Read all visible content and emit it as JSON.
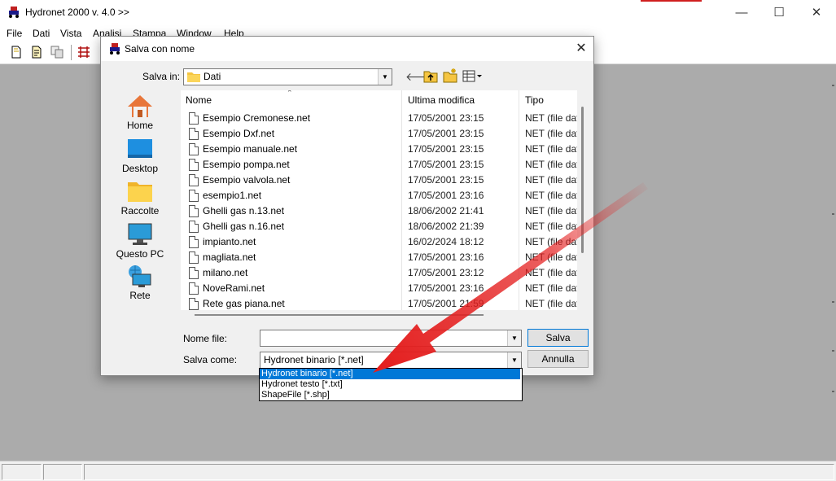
{
  "app": {
    "title": "Hydronet 2000 v. 4.0 >>",
    "window_buttons": {
      "minimize": "—",
      "maximize": "☐",
      "close": "✕"
    }
  },
  "menu": [
    "File",
    "Dati",
    "Vista",
    "Analisi",
    "Stampa",
    "Window",
    "Help"
  ],
  "dialog": {
    "title": "Salva con nome",
    "close": "✕",
    "save_in_label": "Salva in:",
    "save_in_value": "Dati",
    "places": [
      {
        "label": "Home",
        "icon": "home-icon"
      },
      {
        "label": "Desktop",
        "icon": "desktop-icon"
      },
      {
        "label": "Raccolte",
        "icon": "folder-icon"
      },
      {
        "label": "Questo PC",
        "icon": "computer-icon"
      },
      {
        "label": "Rete",
        "icon": "network-icon"
      }
    ],
    "columns": [
      "Nome",
      "Ultima modifica",
      "Tipo"
    ],
    "files": [
      {
        "name": "Esempio Cremonese.net",
        "modified": "17/05/2001 23:15",
        "type": "NET (file dat"
      },
      {
        "name": "Esempio Dxf.net",
        "modified": "17/05/2001 23:15",
        "type": "NET (file dat"
      },
      {
        "name": "Esempio manuale.net",
        "modified": "17/05/2001 23:15",
        "type": "NET (file dat"
      },
      {
        "name": "Esempio pompa.net",
        "modified": "17/05/2001 23:15",
        "type": "NET (file dat"
      },
      {
        "name": "Esempio valvola.net",
        "modified": "17/05/2001 23:15",
        "type": "NET (file dat"
      },
      {
        "name": "esempio1.net",
        "modified": "17/05/2001 23:16",
        "type": "NET (file dat"
      },
      {
        "name": "Ghelli gas n.13.net",
        "modified": "18/06/2002 21:41",
        "type": "NET (file dat"
      },
      {
        "name": "Ghelli gas n.16.net",
        "modified": "18/06/2002 21:39",
        "type": "NET (file dat"
      },
      {
        "name": "impianto.net",
        "modified": "16/02/2024 18:12",
        "type": "NET (file dat"
      },
      {
        "name": "magliata.net",
        "modified": "17/05/2001 23:16",
        "type": "NET (file dat"
      },
      {
        "name": "milano.net",
        "modified": "17/05/2001 23:12",
        "type": "NET (file dat"
      },
      {
        "name": "NoveRami.net",
        "modified": "17/05/2001 23:16",
        "type": "NET (file dat"
      },
      {
        "name": "Rete gas piana.net",
        "modified": "17/05/2001 21:59",
        "type": "NET (file dat"
      }
    ],
    "filename_label": "Nome file:",
    "filename_value": "",
    "saveas_label": "Salva come:",
    "saveas_value": "Hydronet binario [*.net]",
    "save_button": "Salva",
    "cancel_button": "Annulla",
    "filetype_options": [
      "Hydronet binario [*.net]",
      "Hydronet testo [*.txt]",
      "ShapeFile [*.shp]"
    ],
    "selected_option_index": 0
  },
  "colors": {
    "accent": "#0078d7",
    "arrow": "#e41e1e",
    "workspace": "#ababab"
  }
}
